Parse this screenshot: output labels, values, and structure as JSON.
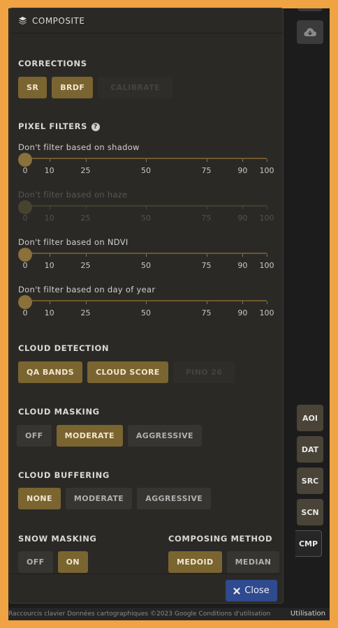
{
  "header": {
    "title": "COMPOSITE",
    "icon": "layers-icon"
  },
  "corrections": {
    "title": "CORRECTIONS",
    "buttons": [
      {
        "label": "SR",
        "state": "on"
      },
      {
        "label": "BRDF",
        "state": "on"
      },
      {
        "label": "CALIBRATE",
        "state": "disabled"
      }
    ]
  },
  "pixel_filters": {
    "title": "PIXEL FILTERS",
    "help_icon": "?",
    "ticks": [
      "0",
      "10",
      "25",
      "50",
      "75",
      "90",
      "100"
    ],
    "filters": [
      {
        "label": "Don't filter based on shadow",
        "value": 0,
        "enabled": true
      },
      {
        "label": "Don't filter based on haze",
        "value": 0,
        "enabled": false
      },
      {
        "label": "Don't filter based on NDVI",
        "value": 0,
        "enabled": true
      },
      {
        "label": "Don't filter based on day of year",
        "value": 0,
        "enabled": true
      }
    ]
  },
  "cloud_detection": {
    "title": "CLOUD DETECTION",
    "buttons": [
      {
        "label": "QA BANDS",
        "state": "on"
      },
      {
        "label": "CLOUD SCORE",
        "state": "on"
      },
      {
        "label": "PINO 26",
        "state": "disabled"
      }
    ]
  },
  "cloud_masking": {
    "title": "CLOUD MASKING",
    "buttons": [
      {
        "label": "OFF",
        "state": "off"
      },
      {
        "label": "MODERATE",
        "state": "on"
      },
      {
        "label": "AGGRESSIVE",
        "state": "off"
      }
    ]
  },
  "cloud_buffering": {
    "title": "CLOUD BUFFERING",
    "buttons": [
      {
        "label": "NONE",
        "state": "on"
      },
      {
        "label": "MODERATE",
        "state": "off"
      },
      {
        "label": "AGGRESSIVE",
        "state": "off"
      }
    ]
  },
  "snow_masking": {
    "title": "SNOW MASKING",
    "buttons": [
      {
        "label": "OFF",
        "state": "off"
      },
      {
        "label": "ON",
        "state": "on"
      }
    ]
  },
  "composing_method": {
    "title": "COMPOSING METHOD",
    "buttons": [
      {
        "label": "MEDOID",
        "state": "on"
      },
      {
        "label": "MEDIAN",
        "state": "off"
      }
    ]
  },
  "close_button": {
    "label": "Close",
    "icon": "close-icon"
  },
  "side_tabs": [
    "AOI",
    "DAT",
    "SRC",
    "SCN",
    "CMP"
  ],
  "active_tab": "CMP",
  "map_footer": {
    "left": "Raccourcis clavier   Données cartographiques ©2023 Google   Conditions d'utilisation",
    "right": "Utilisation"
  },
  "colors": {
    "accent_frame": "#efa342",
    "button_on": "#7a6430",
    "button_off": "#373532",
    "close_button": "#2f4a8e",
    "panel_bg": "#2b2926"
  }
}
